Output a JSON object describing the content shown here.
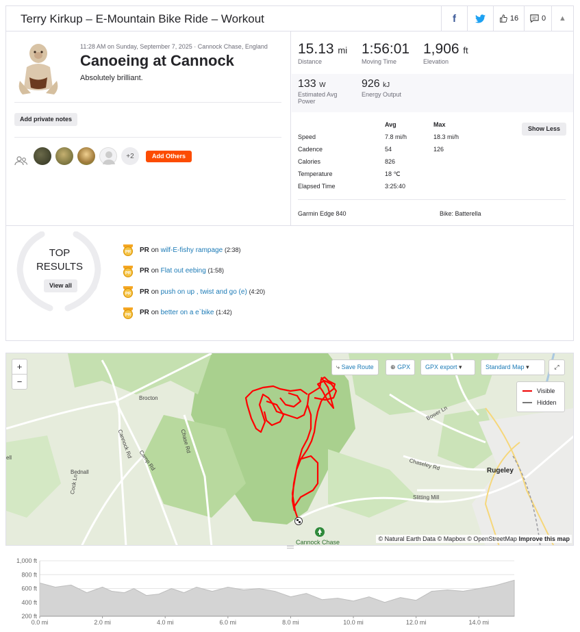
{
  "header": {
    "title": "Terry Kirkup – E-Mountain Bike Ride – Workout",
    "kudos_count": "16",
    "comment_count": "0"
  },
  "activity": {
    "meta": "11:28 AM on Sunday, September 7, 2025 · Cannock Chase, England",
    "name": "Canoeing at Cannock",
    "description": "Absolutely brilliant.",
    "private_notes_label": "Add private notes",
    "others_count": "+2",
    "add_others_label": "Add Others"
  },
  "stats": {
    "distance": {
      "value": "15.13",
      "unit": "mi",
      "label": "Distance"
    },
    "moving_time": {
      "value": "1:56:01",
      "label": "Moving Time"
    },
    "elevation": {
      "value": "1,906",
      "unit": "ft",
      "label": "Elevation"
    },
    "power": {
      "value": "133",
      "unit": "W",
      "label": "Estimated Avg Power"
    },
    "energy": {
      "value": "926",
      "unit": "kJ",
      "label": "Energy Output"
    }
  },
  "details": {
    "avg_header": "Avg",
    "max_header": "Max",
    "show_less_label": "Show Less",
    "rows": [
      {
        "label": "Speed",
        "avg": "7.8 mi/h",
        "max": "18.3 mi/h"
      },
      {
        "label": "Cadence",
        "avg": "54",
        "max": "126"
      },
      {
        "label": "Calories",
        "avg": "826",
        "max": ""
      },
      {
        "label": "Temperature",
        "avg": "18 ℃",
        "max": ""
      },
      {
        "label": "Elapsed Time",
        "avg": "3:25:40",
        "max": ""
      }
    ],
    "device": "Garmin Edge 840",
    "bike": "Bike: Batterella"
  },
  "results": {
    "top_label_1": "TOP",
    "top_label_2": "RESULTS",
    "view_all_label": "View all",
    "items": [
      {
        "pr": "PR",
        "on": "on",
        "segment": "wilf-E-fishy rampage",
        "time": "(2:38)"
      },
      {
        "pr": "PR",
        "on": "on",
        "segment": "Flat out eebing",
        "time": "(1:58)"
      },
      {
        "pr": "PR",
        "on": "on",
        "segment": "push on up , twist and go (e)",
        "time": "(4:20)"
      },
      {
        "pr": "PR",
        "on": "on",
        "segment": "better on a e`bike",
        "time": "(1:42)"
      }
    ]
  },
  "map": {
    "zoom_in": "+",
    "zoom_out": "−",
    "save_route": "Save Route",
    "gpx": "GPX",
    "gpx_export": "GPX export",
    "map_style": "Standard Map",
    "legend_visible": "Visible",
    "legend_hidden": "Hidden",
    "attribution_1": "© Natural Earth Data © Mapbox © OpenStreetMap",
    "attribution_2": "Improve this map",
    "places": [
      "Brocton",
      "Cannock Rd",
      "Chase Rd",
      "Camp Rd",
      "Bednall",
      "Cock Ln",
      "Bower Ln",
      "Chaseley Rd",
      "Rugeley",
      "Slitting Mill",
      "Cannock Chase",
      "ell"
    ],
    "route_color": "#ff0000"
  },
  "chart_data": {
    "type": "area",
    "title": "",
    "xlabel": "",
    "ylabel": "",
    "x_ticks": [
      "0.0 mi",
      "2.0 mi",
      "4.0 mi",
      "6.0 mi",
      "8.0 mi",
      "10.0 mi",
      "12.0 mi",
      "14.0 mi"
    ],
    "y_ticks": [
      "1,000 ft",
      "800 ft",
      "600 ft",
      "400 ft",
      "200 ft"
    ],
    "xlim": [
      0,
      15.13
    ],
    "ylim": [
      200,
      1000
    ],
    "x": [
      0,
      0.5,
      1,
      1.5,
      2,
      2.3,
      2.7,
      3,
      3.4,
      3.8,
      4.2,
      4.6,
      5,
      5.5,
      6,
      6.5,
      7,
      7.5,
      8,
      8.5,
      9,
      9.5,
      10,
      10.5,
      11,
      11.5,
      12,
      12.5,
      13,
      13.5,
      14,
      14.5,
      15.13
    ],
    "elevation": [
      680,
      620,
      650,
      540,
      620,
      560,
      540,
      600,
      500,
      520,
      600,
      540,
      620,
      560,
      620,
      580,
      600,
      560,
      480,
      530,
      440,
      460,
      420,
      480,
      400,
      470,
      430,
      560,
      580,
      560,
      600,
      640,
      720
    ],
    "fill_color": "#d4d4d4"
  }
}
